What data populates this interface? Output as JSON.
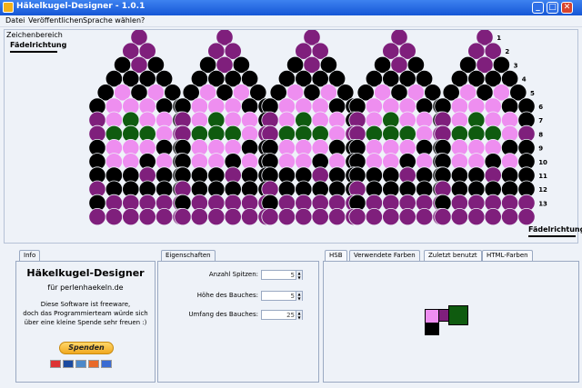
{
  "window": {
    "title": "Häkelkugel-Designer - 1.0.1",
    "minimize_label": "_",
    "maximize_label": "□",
    "close_label": "✕"
  },
  "menu": [
    {
      "label": "Datei"
    },
    {
      "label": "Veröffentlichen"
    },
    {
      "label": "Sprache wählen"
    },
    {
      "label": "?"
    }
  ],
  "canvas": {
    "heading": "Zeichenbereich",
    "direction_label": "Fädelrichtung",
    "pattern_rows": [
      "P",
      "PP",
      "KPK",
      "KKKK",
      "KPKPK",
      "KPPPKK",
      "PPGPPK",
      "PGGGPP",
      "KPPPKK",
      "KPPKPK",
      "KKKPKK",
      "PKKKKK",
      "KPPPPP",
      "PPPPPP"
    ],
    "row_numbers": [
      "1",
      "2",
      "3",
      "4",
      "5",
      "6",
      "7",
      "8",
      "9",
      "10",
      "11",
      "12",
      "13"
    ],
    "colors": {
      "purple": "#7f1f7c",
      "pink": "#ee8ef0",
      "green": "#0f5b0f",
      "black": "#000000"
    }
  },
  "info_panel": {
    "tab": "Info",
    "app_name": "Häkelkugel-Designer",
    "site": "für perlenhaekeln.de",
    "text_line1": "Diese Software ist freeware,",
    "text_line2": "doch das Programmierteam würde sich",
    "text_line3": "über eine kleine Spende sehr freuen :)",
    "donate_label": "Spenden"
  },
  "properties_panel": {
    "tab": "Eigenschaften",
    "fields": [
      {
        "label": "Anzahl Spitzen:",
        "value": "5"
      },
      {
        "label": "Höhe des Bauches:",
        "value": "5"
      },
      {
        "label": "Umfang des Bauches:",
        "value": "25"
      }
    ]
  },
  "colors_panel": {
    "tabs": [
      "HSB",
      "Verwendete Farben",
      "Zuletzt benutzt",
      "HTML-Farben"
    ],
    "active_tab": 1,
    "swatches": [
      {
        "name": "pink",
        "color": "#ee8ef0"
      },
      {
        "name": "purple",
        "color": "#7f1f7c"
      },
      {
        "name": "green",
        "color": "#0f5b0f"
      },
      {
        "name": "black",
        "color": "#000000"
      }
    ]
  }
}
